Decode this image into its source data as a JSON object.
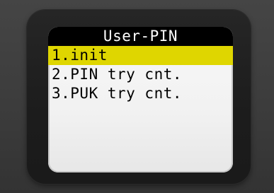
{
  "screen": {
    "title": "User-PIN"
  },
  "menu": {
    "items": [
      {
        "label": "1.init",
        "selected": true
      },
      {
        "label": "2.PIN try cnt.",
        "selected": false
      },
      {
        "label": "3.PUK try cnt.",
        "selected": false
      }
    ]
  },
  "colors": {
    "highlight": "#dfd600",
    "title_bar": "#000000",
    "screen_bg": "#f4f4f4",
    "bezel": "#1f1f1f"
  }
}
